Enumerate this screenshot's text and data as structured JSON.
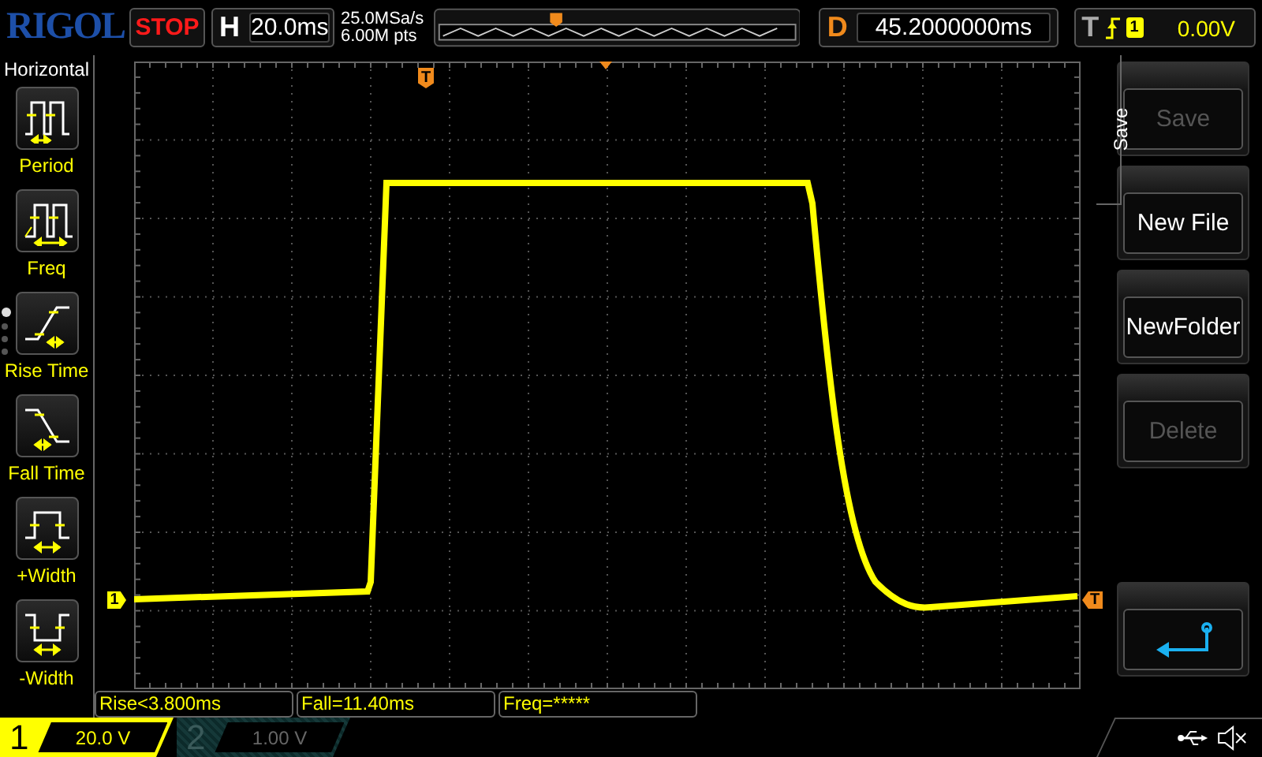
{
  "header": {
    "brand": "RIGOL",
    "run_state": "STOP",
    "timebase": {
      "label": "H",
      "value": "20.0ms"
    },
    "sample_rate": "25.0MSa/s",
    "memory_depth": "6.00M pts",
    "delay": {
      "label": "D",
      "value": "45.2000000ms"
    },
    "trigger": {
      "label": "T",
      "source": "1",
      "level": "0.00V"
    }
  },
  "measure_menu": {
    "title": "Horizontal",
    "pages": [
      {
        "selected": true
      },
      {
        "selected": false
      },
      {
        "selected": false
      },
      {
        "selected": false
      }
    ],
    "items": [
      {
        "kind": "period",
        "label": "Period"
      },
      {
        "kind": "freq",
        "label": "Freq"
      },
      {
        "kind": "rise",
        "label": "Rise Time"
      },
      {
        "kind": "fall",
        "label": "Fall Time"
      },
      {
        "kind": "pwidth",
        "label": "+Width"
      },
      {
        "kind": "nwidth",
        "label": "-Width"
      }
    ]
  },
  "markers": {
    "trigger_position": "T",
    "trigger_level": "T",
    "channel": "1"
  },
  "measurements": [
    "Rise<3.800ms",
    "Fall=11.40ms",
    "Freq=*****"
  ],
  "channels": [
    {
      "label": "1",
      "scale": "20.0 V",
      "active": true
    },
    {
      "label": "2",
      "scale": "1.00 V",
      "active": false
    }
  ],
  "softkey_menu": {
    "title": "Save",
    "buttons": [
      {
        "label": "Save",
        "disabled": true
      },
      {
        "label": "New File",
        "disabled": false
      },
      {
        "label": "NewFolder",
        "disabled": false
      },
      {
        "label": "Delete",
        "disabled": true
      }
    ]
  }
}
